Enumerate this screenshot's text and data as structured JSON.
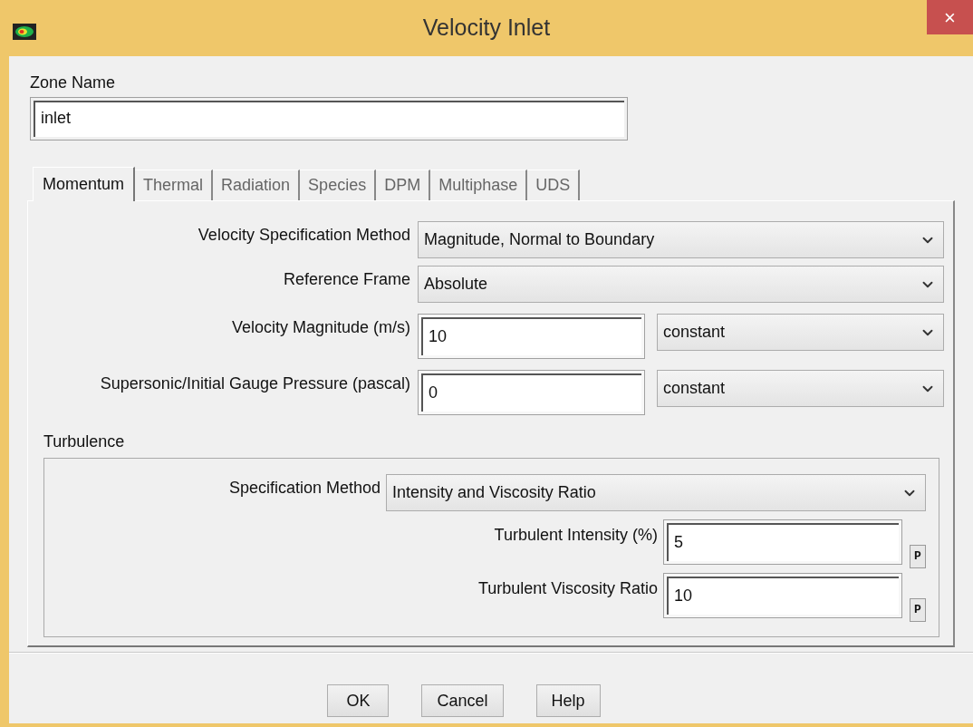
{
  "window": {
    "title": "Velocity Inlet",
    "close": "×"
  },
  "zone_name": {
    "label": "Zone Name",
    "value": "inlet"
  },
  "tabs": [
    {
      "label": "Momentum",
      "selected": true
    },
    {
      "label": "Thermal",
      "selected": false
    },
    {
      "label": "Radiation",
      "selected": false
    },
    {
      "label": "Species",
      "selected": false
    },
    {
      "label": "DPM",
      "selected": false
    },
    {
      "label": "Multiphase",
      "selected": false
    },
    {
      "label": "UDS",
      "selected": false
    }
  ],
  "momentum": {
    "fields": [
      {
        "kind": "dropdown",
        "label": "Velocity Specification Method",
        "value": "Magnitude, Normal to Boundary"
      },
      {
        "kind": "dropdown",
        "label": "Reference Frame",
        "value": "Absolute"
      },
      {
        "kind": "profile",
        "label": "Velocity Magnitude (m/s)",
        "value": "10",
        "profile": "constant"
      },
      {
        "kind": "profile",
        "label": "Supersonic/Initial Gauge Pressure (pascal)",
        "value": "0",
        "profile": "constant"
      }
    ]
  },
  "turbulence": {
    "title": "Turbulence",
    "fields": [
      {
        "kind": "dropdown",
        "label": "Specification Method",
        "value": "Intensity and Viscosity Ratio"
      },
      {
        "kind": "parameter",
        "label": "Turbulent Intensity (%)",
        "value": "5",
        "button": "P"
      },
      {
        "kind": "parameter",
        "label": "Turbulent Viscosity Ratio",
        "value": "10",
        "button": "P"
      }
    ]
  },
  "buttons": [
    "OK",
    "Cancel",
    "Help"
  ]
}
